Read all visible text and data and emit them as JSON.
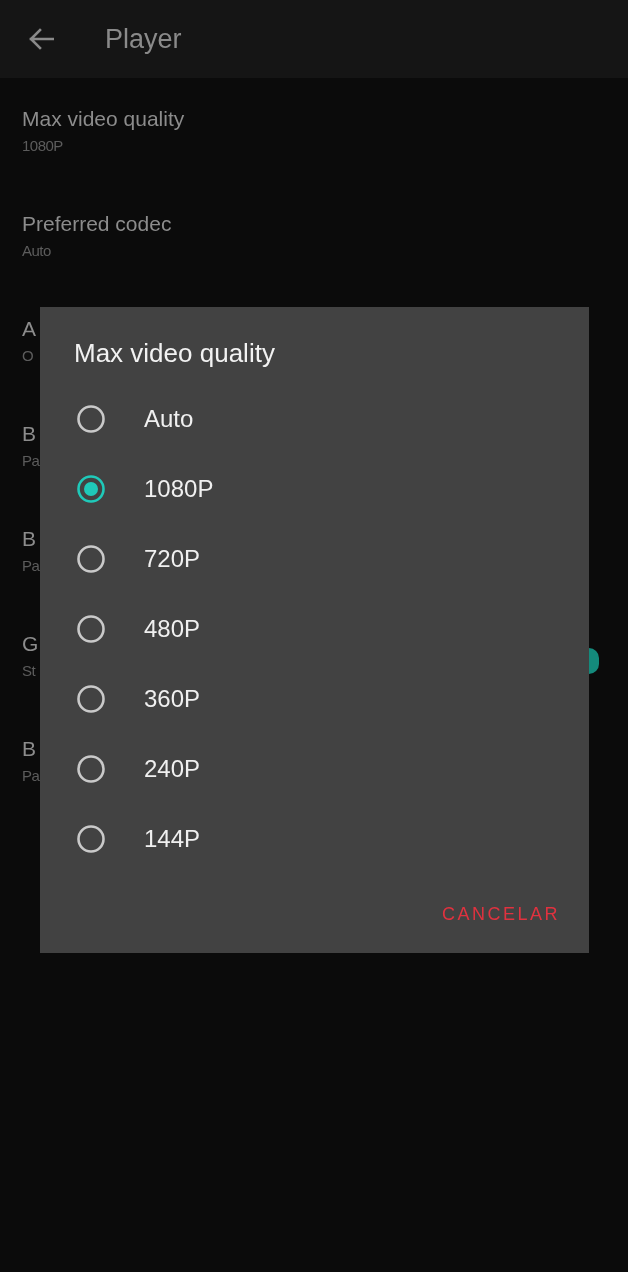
{
  "app_bar": {
    "title": "Player"
  },
  "settings": [
    {
      "kind": "text",
      "title": "Max video quality",
      "value": "1080P"
    },
    {
      "kind": "text",
      "title": "Preferred codec",
      "value": "Auto"
    },
    {
      "kind": "text",
      "title": "A",
      "value": "O"
    },
    {
      "kind": "text",
      "title": "B",
      "value": "Pa"
    },
    {
      "kind": "text",
      "title": "B",
      "value": "Pa"
    },
    {
      "kind": "toggle",
      "title": "G",
      "value": "St",
      "on": true
    },
    {
      "kind": "text",
      "title": "B",
      "value": "Pa"
    }
  ],
  "dialog": {
    "title": "Max video quality",
    "options": [
      {
        "label": "Auto",
        "selected": false
      },
      {
        "label": "1080P",
        "selected": true
      },
      {
        "label": "720P",
        "selected": false
      },
      {
        "label": "480P",
        "selected": false
      },
      {
        "label": "360P",
        "selected": false
      },
      {
        "label": "240P",
        "selected": false
      },
      {
        "label": "144P",
        "selected": false
      }
    ],
    "buttons": [
      "CANCELAR"
    ]
  }
}
